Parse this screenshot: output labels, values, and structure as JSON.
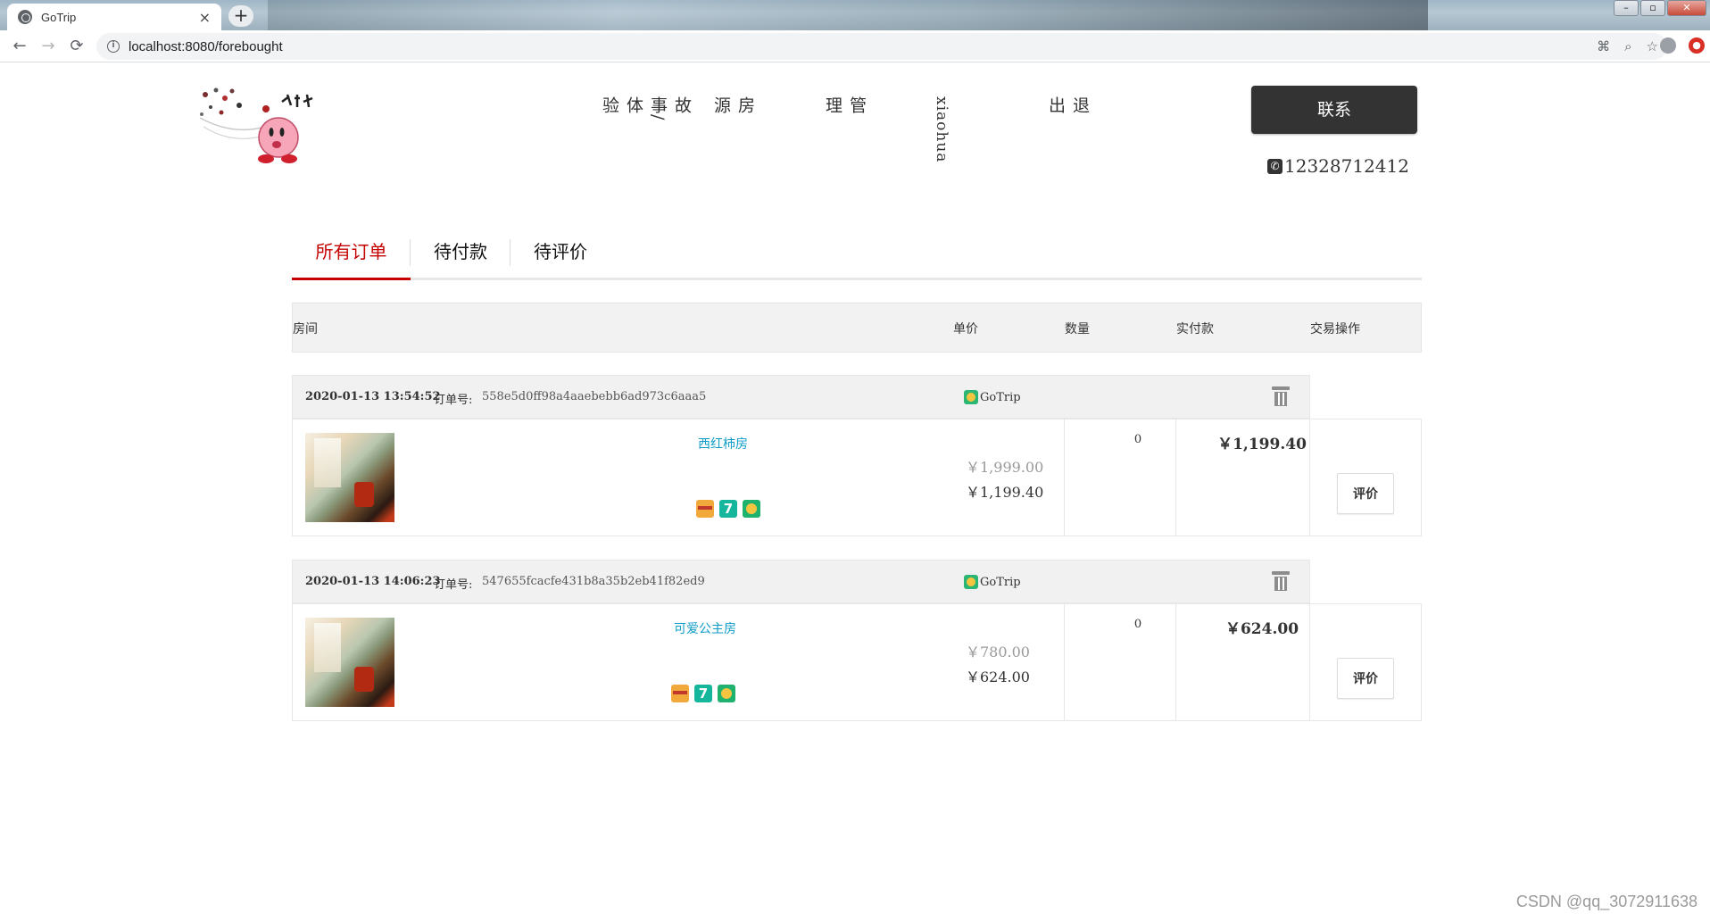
{
  "browser": {
    "tab_title": "GoTrip",
    "tab_close": "×",
    "new_tab": "+",
    "url": "localhost:8080/forebought",
    "nav": {
      "back": "←",
      "forward": "→",
      "reload": "⟳"
    },
    "window_controls": {
      "minimize": "–",
      "restore": "▫",
      "close": "✕"
    }
  },
  "header": {
    "nav": [
      "故事/体验",
      "房源",
      "管理",
      "xiaohua",
      "退出"
    ],
    "contact_label": "联系",
    "phone": "12328712412"
  },
  "order_tabs": [
    {
      "label": "所有订单",
      "active": true
    },
    {
      "label": "待付款",
      "active": false
    },
    {
      "label": "待评价",
      "active": false
    }
  ],
  "table_header": {
    "room": "房间",
    "unit_price": "单价",
    "quantity": "数量",
    "paid": "实付款",
    "operation": "交易操作"
  },
  "orders": [
    {
      "date": "2020-01-13 13:54:52",
      "order_no_label": "订单号:",
      "order_no": "558e5d0ff98a4aaebebb6ad973c6aaa5",
      "shop": "GoTrip",
      "room_name": "西红柿房",
      "original_price": "￥1,999.00",
      "current_price": "￥1,199.40",
      "quantity": "0",
      "paid": "￥1,199.40",
      "action": "评价"
    },
    {
      "date": "2020-01-13 14:06:23",
      "order_no_label": "订单号:",
      "order_no": "547655fcacfe431b8a35b2eb41f82ed9",
      "shop": "GoTrip",
      "room_name": "可爱公主房",
      "original_price": "￥780.00",
      "current_price": "￥624.00",
      "quantity": "0",
      "paid": "￥624.00",
      "action": "评价"
    }
  ],
  "watermark": "CSDN @qq_3072911638"
}
